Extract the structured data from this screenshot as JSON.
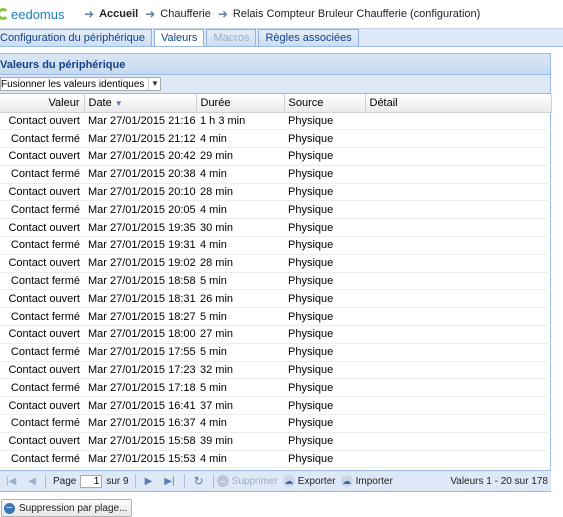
{
  "app": {
    "logo_text": "eedomus"
  },
  "breadcrumb": [
    {
      "label": "Accueil",
      "bold": true
    },
    {
      "label": "Chaufferie",
      "bold": false
    },
    {
      "label": "Relais Compteur Bruleur Chaufferie (configuration)",
      "bold": false
    }
  ],
  "tabs": [
    {
      "label": "Configuration du périphérique",
      "state": "normal"
    },
    {
      "label": "Valeurs",
      "state": "active"
    },
    {
      "label": "Macros",
      "state": "disabled"
    },
    {
      "label": "Règles associées",
      "state": "normal"
    }
  ],
  "panel": {
    "title": "Valeurs du périphérique",
    "merge_select": "Fusionner les valeurs identiques"
  },
  "grid": {
    "columns": [
      "Valeur",
      "Date",
      "Durée",
      "Source",
      "Détail"
    ],
    "rows": [
      [
        "Contact ouvert",
        "Mar 27/01/2015 21:16:29",
        "1 h 3 min",
        "Physique",
        ""
      ],
      [
        "Contact fermé",
        "Mar 27/01/2015 21:12:05",
        "4 min",
        "Physique",
        ""
      ],
      [
        "Contact ouvert",
        "Mar 27/01/2015 20:42:53",
        "29 min",
        "Physique",
        ""
      ],
      [
        "Contact fermé",
        "Mar 27/01/2015 20:38:26",
        "4 min",
        "Physique",
        ""
      ],
      [
        "Contact ouvert",
        "Mar 27/01/2015 20:10:13",
        "28 min",
        "Physique",
        ""
      ],
      [
        "Contact fermé",
        "Mar 27/01/2015 20:05:48",
        "4 min",
        "Physique",
        ""
      ],
      [
        "Contact ouvert",
        "Mar 27/01/2015 19:35:31",
        "30 min",
        "Physique",
        ""
      ],
      [
        "Contact fermé",
        "Mar 27/01/2015 19:31:10",
        "4 min",
        "Physique",
        ""
      ],
      [
        "Contact ouvert",
        "Mar 27/01/2015 19:02:50",
        "28 min",
        "Physique",
        ""
      ],
      [
        "Contact fermé",
        "Mar 27/01/2015 18:58:18",
        "5 min",
        "Physique",
        ""
      ],
      [
        "Contact ouvert",
        "Mar 27/01/2015 18:31:52",
        "26 min",
        "Physique",
        ""
      ],
      [
        "Contact fermé",
        "Mar 27/01/2015 18:27:05",
        "5 min",
        "Physique",
        ""
      ],
      [
        "Contact ouvert",
        "Mar 27/01/2015 18:00:05",
        "27 min",
        "Physique",
        ""
      ],
      [
        "Contact fermé",
        "Mar 27/01/2015 17:55:23",
        "5 min",
        "Physique",
        ""
      ],
      [
        "Contact ouvert",
        "Mar 27/01/2015 17:23:04",
        "32 min",
        "Physique",
        ""
      ],
      [
        "Contact fermé",
        "Mar 27/01/2015 17:18:34",
        "5 min",
        "Physique",
        ""
      ],
      [
        "Contact ouvert",
        "Mar 27/01/2015 16:41:30",
        "37 min",
        "Physique",
        ""
      ],
      [
        "Contact fermé",
        "Mar 27/01/2015 16:37:06",
        "4 min",
        "Physique",
        ""
      ],
      [
        "Contact ouvert",
        "Mar 27/01/2015 15:58:23",
        "39 min",
        "Physique",
        ""
      ],
      [
        "Contact fermé",
        "Mar 27/01/2015 15:53:55",
        "4 min",
        "Physique",
        ""
      ]
    ]
  },
  "pager": {
    "page_label": "Page",
    "page_value": "1",
    "of_label": "sur 9",
    "delete_label": "Supprimer",
    "export_label": "Exporter",
    "import_label": "Importer",
    "info": "Valeurs 1 - 20 sur 178"
  },
  "bottom_button": {
    "label": "Suppression par plage..."
  }
}
